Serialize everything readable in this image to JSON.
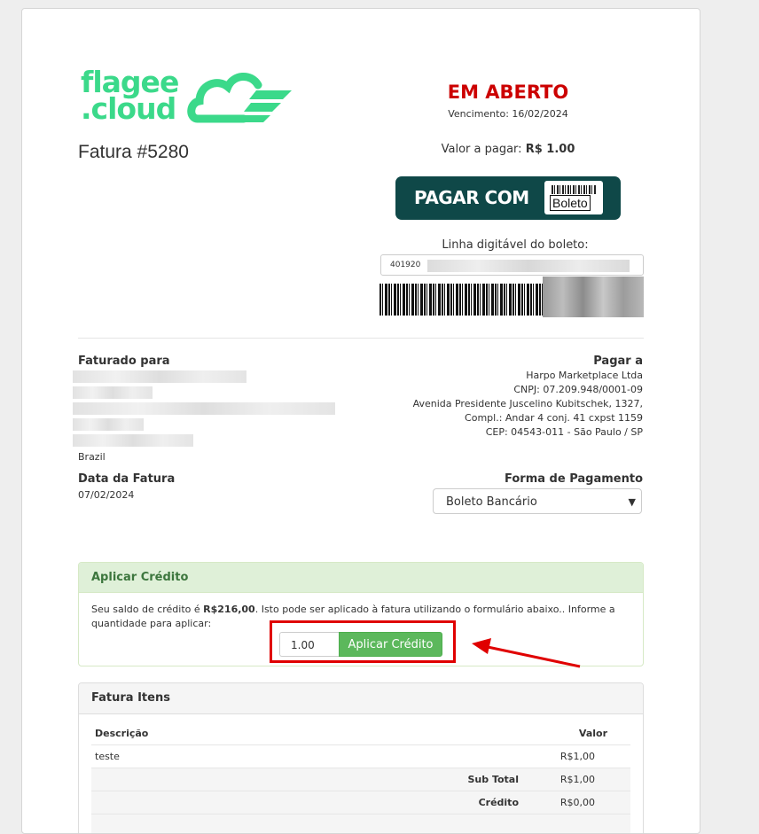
{
  "brand": {
    "logo_line1": "flagee",
    "logo_line2": ".cloud"
  },
  "invoice": {
    "title": "Fatura #5280",
    "status": "EM ABERTO",
    "due": "Vencimento: 16/02/2024",
    "amount_label": "Valor a pagar:",
    "amount_value": "R$ 1.00",
    "pay_button": {
      "label": "PAGAR COM",
      "badge": "Boleto"
    },
    "boleto_line_label": "Linha digitável do boleto:",
    "boleto_line_value": "401920"
  },
  "billed_to": {
    "heading": "Faturado para",
    "country": "Brazil"
  },
  "pay_to": {
    "heading": "Pagar a",
    "lines": [
      "Harpo Marketplace Ltda",
      "CNPJ: 07.209.948/0001-09",
      "Avenida Presidente Juscelino Kubitschek, 1327,",
      "Compl.: Andar 4 conj. 41 cxpst 1159",
      "CEP: 04543-011 - São Paulo / SP"
    ]
  },
  "invoice_date": {
    "heading": "Data da Fatura",
    "value": "07/02/2024"
  },
  "payment_method": {
    "heading": "Forma de Pagamento",
    "selected": "Boleto Bancário"
  },
  "credit": {
    "heading": "Aplicar Crédito",
    "text_before": "Seu saldo de crédito é ",
    "balance": "R$216,00",
    "text_after": ". Isto pode ser aplicado à fatura utilizando o formulário abaixo.. Informe a quantidade para aplicar:",
    "input_value": "1.00",
    "button_label": "Aplicar Crédito"
  },
  "items": {
    "heading": "Fatura Itens",
    "col_description": "Descrição",
    "col_value": "Valor",
    "rows": [
      {
        "description": "teste",
        "value": "R$1,00"
      }
    ],
    "subtotal_label": "Sub Total",
    "subtotal_value": "R$1,00",
    "credit_label": "Crédito",
    "credit_value": "R$0,00"
  },
  "colors": {
    "status_red": "#cc0000",
    "brand_green": "#3bd98a",
    "pay_button_bg": "#0f4848",
    "credit_green": "#5cb85c",
    "annotation_red": "#e00000"
  }
}
